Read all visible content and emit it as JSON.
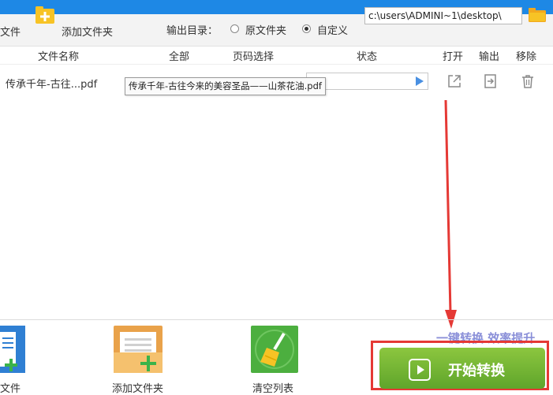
{
  "toolbar": {
    "add_file_label": "文件",
    "add_folder_label": "添加文件夹",
    "output_dir_label": "输出目录：",
    "radio_original_label": "原文件夹",
    "radio_custom_label": "自定义",
    "radio_selected": "自定义",
    "output_path_value": "c:\\users\\ADMINI~1\\desktop\\"
  },
  "columns": {
    "file_name": "文件名称",
    "all": "全部",
    "page_select": "页码选择",
    "status": "状态",
    "open": "打开",
    "output": "输出",
    "remove": "移除"
  },
  "files": [
    {
      "name": "传承千年-古往...pdf",
      "tooltip": "传承千年-古往今来的美容圣品——山茶花油.pdf"
    }
  ],
  "bottom": {
    "add_file_label": "文件",
    "add_folder_label": "添加文件夹",
    "clear_list_label": "清空列表",
    "promo_text": "一键转换  效率提升",
    "start_button_label": "开始转换"
  },
  "colors": {
    "accent_blue": "#1e88e5",
    "start_green": "#6db33f",
    "highlight_red": "#e53935",
    "promo_purple": "#8a8fd8"
  }
}
